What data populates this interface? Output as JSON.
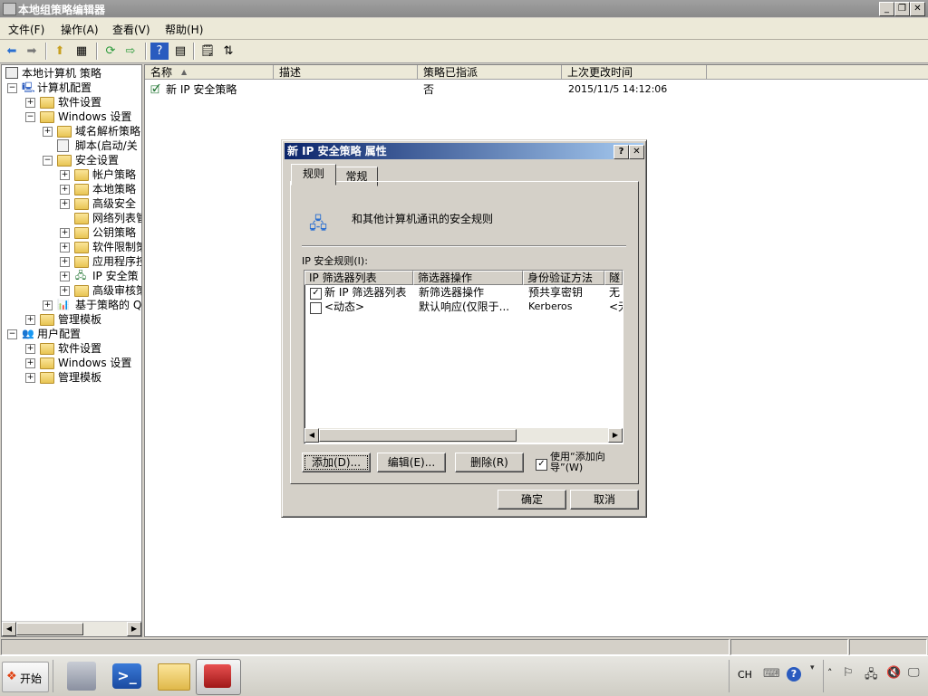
{
  "window": {
    "title": "本地组策略编辑器",
    "min": "_",
    "max": "❐",
    "close": "✕"
  },
  "menu": [
    "文件(F)",
    "操作(A)",
    "查看(V)",
    "帮助(H)"
  ],
  "tree": {
    "root": "本地计算机 策略",
    "computer": "计算机配置",
    "software": "软件设置",
    "windows": "Windows 设置",
    "dns": "域名解析策略",
    "scripts": "脚本(启动/关",
    "security": "安全设置",
    "account": "帐户策略",
    "local": "本地策略",
    "advsec": "高级安全",
    "netlist": "网络列表管",
    "pubkey": "公钥策略",
    "swrestrict": "软件限制策",
    "appctl": "应用程序控",
    "ipsec": "IP 安全策",
    "audit": "高级审核策",
    "qos": "基于策略的 Q",
    "admintpl": "管理模板",
    "user": "用户配置",
    "u_software": "软件设置",
    "u_windows": "Windows 设置",
    "u_admintpl": "管理模板"
  },
  "list": {
    "headers": {
      "name": "名称",
      "desc": "描述",
      "assigned": "策略已指派",
      "modified": "上次更改时间"
    },
    "row": {
      "name": "新 IP 安全策略",
      "desc": "",
      "assigned": "否",
      "modified": "2015/11/5 14:12:06"
    }
  },
  "dialog": {
    "title": "新 IP 安全策略 属性",
    "help": "?",
    "close": "✕",
    "tabs": [
      "规则",
      "常规"
    ],
    "intro": "和其他计算机通讯的安全规则",
    "rules_label": "IP 安全规则(I):",
    "columns": [
      "IP 筛选器列表",
      "筛选器操作",
      "身份验证方法",
      "隧"
    ],
    "rows": [
      {
        "filter": "新 IP 筛选器列表",
        "action": "新筛选器操作",
        "auth": "预共享密钥",
        "tunnel": "无",
        "checked": true
      },
      {
        "filter": "<动态>",
        "action": "默认响应(仅限于...",
        "auth": "Kerberos",
        "tunnel": "<无",
        "checked": false
      }
    ],
    "buttons": {
      "add": "添加(D)...",
      "edit": "编辑(E)...",
      "remove": "删除(R)",
      "ok": "确定",
      "cancel": "取消"
    },
    "wizard": "使用“添加向导”(W)",
    "wizard_checked": true
  },
  "taskbar": {
    "start": "开始",
    "lang": "CH"
  }
}
